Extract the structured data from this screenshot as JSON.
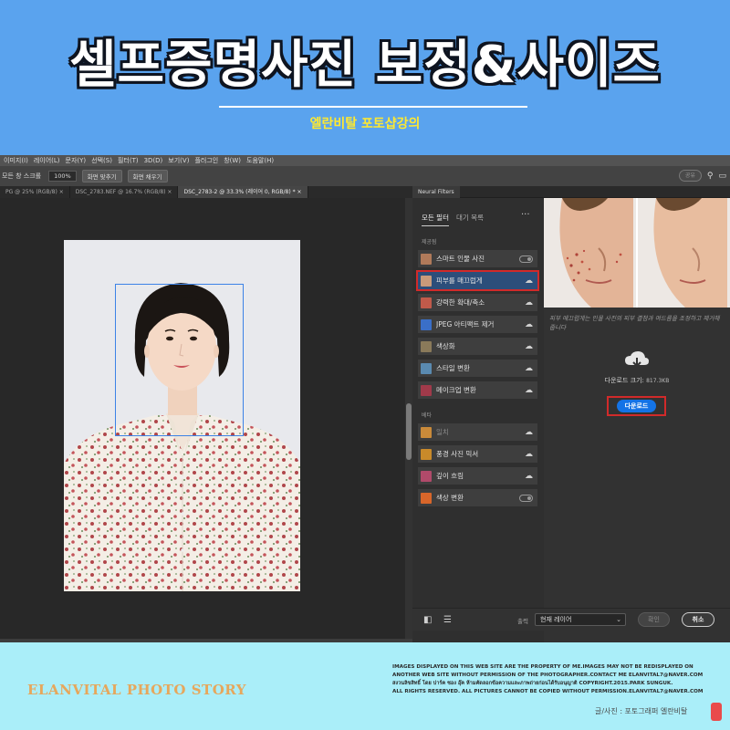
{
  "banner": {
    "title": "셀프증명사진 보정&사이즈",
    "subtitle": "엘란비탈 포토샵강의"
  },
  "photoshop": {
    "menu": [
      "이미지(I)",
      "레이어(L)",
      "문자(Y)",
      "선택(S)",
      "필터(T)",
      "3D(D)",
      "보기(V)",
      "플러그인",
      "창(W)",
      "도움말(H)"
    ],
    "options": {
      "scroll_all": "모든 창 스크롤",
      "zoom": "100%",
      "fit_screen": "화면 맞추기",
      "fill_screen": "화면 채우기"
    },
    "share_label": "공유",
    "doc_tabs": [
      {
        "label": "PG @ 25% (RGB/8)",
        "active": false
      },
      {
        "label": "DSC_2783.NEF @ 16.7% (RGB/8)",
        "active": false
      },
      {
        "label": "DSC_2783-2 @ 33.3% (레이어 0, RGB/8) *",
        "active": true
      }
    ]
  },
  "neural_filters": {
    "panel_title": "Neural Filters",
    "tabs": [
      "모든 필터",
      "대기 목록"
    ],
    "more_icon": "more-icon",
    "section_featured": "제공됨",
    "section_beta": "베타",
    "featured": [
      {
        "label": "스마트 인물 사진",
        "icon_color": "#b07a5a",
        "action": "toggle",
        "state": "off"
      },
      {
        "label": "피부를 매끄럽게",
        "icon_color": "#c99a7a",
        "action": "download",
        "state": "selected"
      },
      {
        "label": "강력한 확대/축소",
        "icon_color": "#c05a4a",
        "action": "download",
        "state": "normal"
      },
      {
        "label": "JPEG 아티팩트 제거",
        "icon_color": "#3a6fc8",
        "action": "download",
        "state": "normal"
      },
      {
        "label": "색상화",
        "icon_color": "#8a7a5a",
        "action": "download",
        "state": "normal"
      },
      {
        "label": "스타일 변환",
        "icon_color": "#5a8ab0",
        "action": "download",
        "state": "normal"
      },
      {
        "label": "메이크업 변환",
        "icon_color": "#a03a4a",
        "action": "download",
        "state": "normal"
      }
    ],
    "beta": [
      {
        "label": "일치",
        "icon_color": "#c98a3a",
        "action": "download",
        "state": "dim"
      },
      {
        "label": "풍경 사진 믹서",
        "icon_color": "#c98a2a",
        "action": "download",
        "state": "normal"
      },
      {
        "label": "깊이 흐림",
        "icon_color": "#b04a6a",
        "action": "download",
        "state": "normal"
      },
      {
        "label": "색상 변환",
        "icon_color": "#d8662a",
        "action": "toggle",
        "state": "off"
      }
    ],
    "description": "피부 매끄럽게는 인물 사진의 피부 결점과 여드름을 조정하고 제거해 줍니다",
    "download_size_label": "다운로드 크기:",
    "download_size_value": "817.3KB",
    "download_button": "다운로드",
    "output_label": "출력",
    "output_value": "현재 레이어",
    "ok_button": "확인",
    "cancel_button": "취소"
  },
  "footer": {
    "brand": "ELANVITAL PHOTO  STORY",
    "copyright_lines": [
      "IMAGES DISPLAYED ON THIS WEB SITE ARE THE PROPERTY OF ME.IMAGES MAY NOT BE REDISPLAYED ON",
      "ANOTHER WEB SITE WITHOUT PERMISSION OF THE  PHOTOGRAPHER.CONTACT ME ELANVITAL7@NAVER.COM",
      "สงวนลิขสิทธิ์ โดย ปาร์ค ซอง อุ๊ค  ห้ามคัดลอกข้อความและภาพถ่ายก่อนได้รับอนุญาติ COPYRIGHT.2015.PARK SUNGUK.",
      "ALL RIGHTS RESERVED. ALL PICTURES CANNOT BE COPIED WITHOUT PERMISSION.ELANVITAL7@NAVER.COM"
    ],
    "credit": "글/사진 : 포토그래퍼 엘란비탈",
    "seal_text": "엘란"
  }
}
